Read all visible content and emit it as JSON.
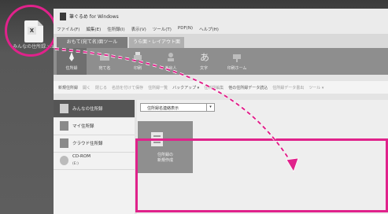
{
  "desktop_icon": {
    "badge": "X",
    "label": "みんなの住所録.xlsx"
  },
  "window": {
    "title": "筆ぐるめ for Windows",
    "menu": [
      "ファイル(F)",
      "編集(E)",
      "住所録(I)",
      "表示(V)",
      "ツール(T)",
      "PDF(N)",
      "ヘルプ(H)"
    ],
    "tabs": [
      "おもて(宛て名)面ツール",
      "うら面・レイアウト面"
    ],
    "ribbon": [
      "住所録",
      "宛て名",
      "印刷",
      "差出人",
      "文字",
      "印刷ホーム"
    ],
    "toolbar": [
      "新規住所録",
      "開く",
      "閉じる",
      "名前を付けて保存",
      "住所録一覧",
      "バックアップ ▾",
      "住所録編集",
      "他の住所録データ読込",
      "住所録データ書出",
      "ツール ▾"
    ],
    "sidebar": [
      {
        "label": "みんなの住所録",
        "sub": ""
      },
      {
        "label": "マイ住所録",
        "sub": ""
      },
      {
        "label": "クラウド住所録",
        "sub": ""
      },
      {
        "label": "CD-ROM",
        "sub": "(E:)"
      }
    ],
    "view_select": {
      "label": "住所録名連絡表示",
      "arrow": "▾"
    },
    "new_tile": {
      "label_line1": "住所録の",
      "label_line2": "新規作成"
    }
  },
  "accent_color": "#e0228b"
}
